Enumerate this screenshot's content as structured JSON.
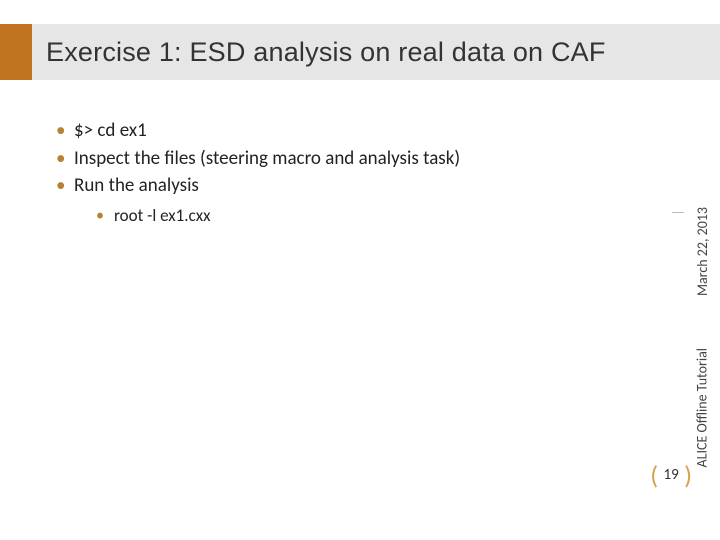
{
  "title": "Exercise 1: ESD analysis on real data on CAF",
  "bullets": [
    "$> cd ex1",
    "Inspect the files (steering macro and analysis task)",
    "Run the analysis"
  ],
  "sub_bullets": [
    "root -l ex1.cxx"
  ],
  "sidebar": {
    "date": "March 22, 2013",
    "tutorial": "ALICE Offline Tutorial"
  },
  "page_number": "19"
}
